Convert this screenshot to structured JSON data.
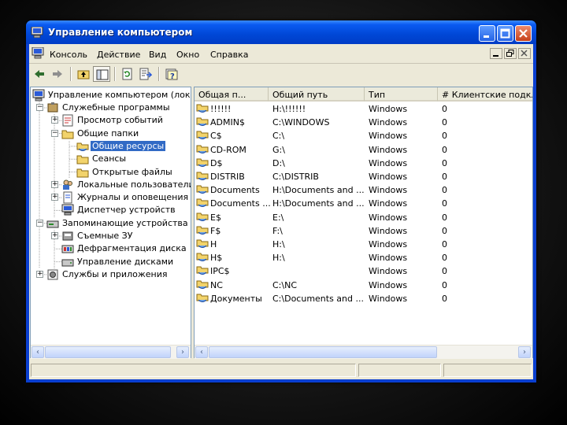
{
  "window": {
    "title": "Управление компьютером",
    "colors": {
      "titlebar": "#0047d6",
      "selection": "#316ac5",
      "face": "#ece9d8"
    }
  },
  "menu": {
    "items": [
      "Консоль",
      "Действие",
      "Вид",
      "Окно",
      "Справка"
    ]
  },
  "toolbar": {
    "icons": [
      "back-arrow-icon",
      "forward-arrow-icon",
      "up-folder-icon",
      "show-tree-icon",
      "refresh-icon",
      "export-list-icon",
      "help-icon"
    ]
  },
  "tree": {
    "root": "Управление компьютером (локаль",
    "items": [
      {
        "label": "Служебные программы",
        "expander": "−"
      },
      {
        "label": "Просмотр событий",
        "expander": "+"
      },
      {
        "label": "Общие папки",
        "expander": "−"
      },
      {
        "label": "Общие ресурсы",
        "expander": ""
      },
      {
        "label": "Сеансы",
        "expander": ""
      },
      {
        "label": "Открытые файлы",
        "expander": ""
      },
      {
        "label": "Локальные пользователи и",
        "expander": "+"
      },
      {
        "label": "Журналы и оповещения пр",
        "expander": "+"
      },
      {
        "label": "Диспетчер устройств",
        "expander": ""
      },
      {
        "label": "Запоминающие устройства",
        "expander": "−"
      },
      {
        "label": "Съемные ЗУ",
        "expander": "+"
      },
      {
        "label": "Дефрагментация диска",
        "expander": ""
      },
      {
        "label": "Управление дисками",
        "expander": ""
      },
      {
        "label": "Службы и приложения",
        "expander": "+"
      }
    ]
  },
  "list": {
    "columns": [
      "Общая п...",
      "Общий путь",
      "Тип",
      "# Клиентские подклю"
    ],
    "rows": [
      {
        "name": "!!!!!!",
        "path": "H:\\!!!!!!",
        "type": "Windows",
        "clients": "0"
      },
      {
        "name": "ADMIN$",
        "path": "C:\\WINDOWS",
        "type": "Windows",
        "clients": "0"
      },
      {
        "name": "C$",
        "path": "C:\\",
        "type": "Windows",
        "clients": "0"
      },
      {
        "name": "CD-ROM",
        "path": "G:\\",
        "type": "Windows",
        "clients": "0"
      },
      {
        "name": "D$",
        "path": "D:\\",
        "type": "Windows",
        "clients": "0"
      },
      {
        "name": "DISTRIB",
        "path": "C:\\DISTRIB",
        "type": "Windows",
        "clients": "0"
      },
      {
        "name": "Documents",
        "path": "H:\\Documents and ...",
        "type": "Windows",
        "clients": "0"
      },
      {
        "name": "Documents ...",
        "path": "H:\\Documents and ...",
        "type": "Windows",
        "clients": "0"
      },
      {
        "name": "E$",
        "path": "E:\\",
        "type": "Windows",
        "clients": "0"
      },
      {
        "name": "F$",
        "path": "F:\\",
        "type": "Windows",
        "clients": "0"
      },
      {
        "name": "H",
        "path": "H:\\",
        "type": "Windows",
        "clients": "0"
      },
      {
        "name": "H$",
        "path": "H:\\",
        "type": "Windows",
        "clients": "0"
      },
      {
        "name": "IPC$",
        "path": "",
        "type": "Windows",
        "clients": "0"
      },
      {
        "name": "NC",
        "path": "C:\\NC",
        "type": "Windows",
        "clients": "0"
      },
      {
        "name": "Документы",
        "path": "C:\\Documents and ...",
        "type": "Windows",
        "clients": "0"
      }
    ]
  }
}
